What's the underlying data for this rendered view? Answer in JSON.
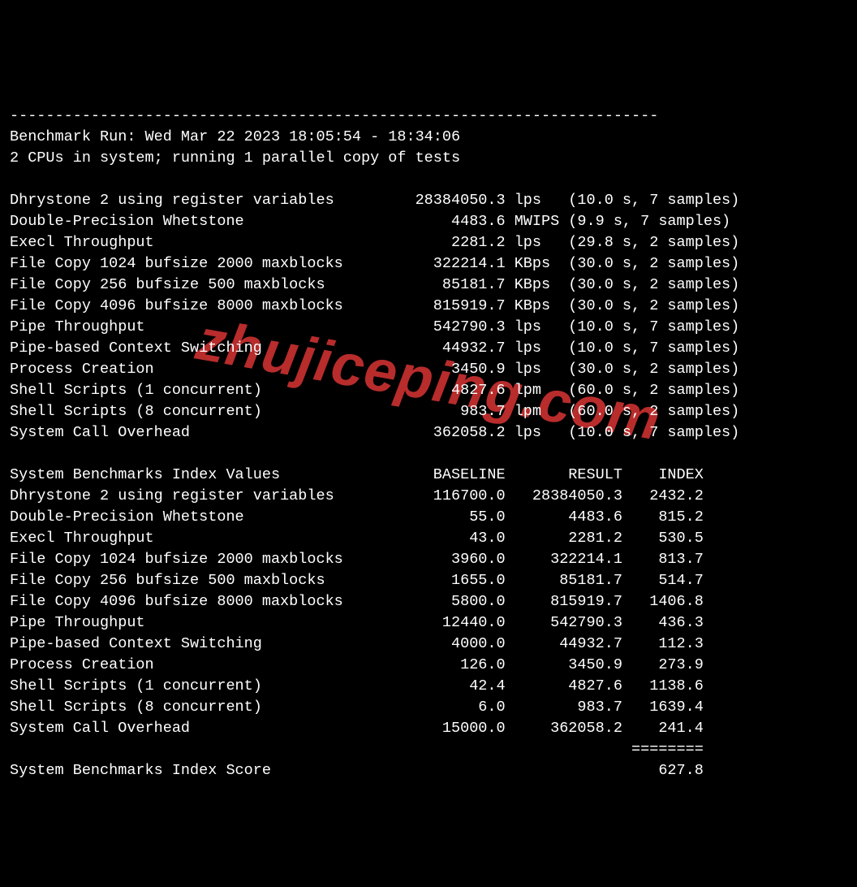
{
  "divider": "------------------------------------------------------------------------",
  "run_line": "Benchmark Run: Wed Mar 22 2023 18:05:54 - 18:34:06",
  "cpu_line": "2 CPUs in system; running 1 parallel copy of tests",
  "tests": [
    {
      "name": "Dhrystone 2 using register variables",
      "value": "28384050.3",
      "unit": "lps",
      "timing": "(10.0 s, 7 samples)"
    },
    {
      "name": "Double-Precision Whetstone",
      "value": "4483.6",
      "unit": "MWIPS",
      "timing": "(9.9 s, 7 samples)"
    },
    {
      "name": "Execl Throughput",
      "value": "2281.2",
      "unit": "lps",
      "timing": "(29.8 s, 2 samples)"
    },
    {
      "name": "File Copy 1024 bufsize 2000 maxblocks",
      "value": "322214.1",
      "unit": "KBps",
      "timing": "(30.0 s, 2 samples)"
    },
    {
      "name": "File Copy 256 bufsize 500 maxblocks",
      "value": "85181.7",
      "unit": "KBps",
      "timing": "(30.0 s, 2 samples)"
    },
    {
      "name": "File Copy 4096 bufsize 8000 maxblocks",
      "value": "815919.7",
      "unit": "KBps",
      "timing": "(30.0 s, 2 samples)"
    },
    {
      "name": "Pipe Throughput",
      "value": "542790.3",
      "unit": "lps",
      "timing": "(10.0 s, 7 samples)"
    },
    {
      "name": "Pipe-based Context Switching",
      "value": "44932.7",
      "unit": "lps",
      "timing": "(10.0 s, 7 samples)"
    },
    {
      "name": "Process Creation",
      "value": "3450.9",
      "unit": "lps",
      "timing": "(30.0 s, 2 samples)"
    },
    {
      "name": "Shell Scripts (1 concurrent)",
      "value": "4827.6",
      "unit": "lpm",
      "timing": "(60.0 s, 2 samples)"
    },
    {
      "name": "Shell Scripts (8 concurrent)",
      "value": "983.7",
      "unit": "lpm",
      "timing": "(60.0 s, 2 samples)"
    },
    {
      "name": "System Call Overhead",
      "value": "362058.2",
      "unit": "lps",
      "timing": "(10.0 s, 7 samples)"
    }
  ],
  "index_header": {
    "title": "System Benchmarks Index Values",
    "col1": "BASELINE",
    "col2": "RESULT",
    "col3": "INDEX"
  },
  "index_rows": [
    {
      "name": "Dhrystone 2 using register variables",
      "baseline": "116700.0",
      "result": "28384050.3",
      "index": "2432.2"
    },
    {
      "name": "Double-Precision Whetstone",
      "baseline": "55.0",
      "result": "4483.6",
      "index": "815.2"
    },
    {
      "name": "Execl Throughput",
      "baseline": "43.0",
      "result": "2281.2",
      "index": "530.5"
    },
    {
      "name": "File Copy 1024 bufsize 2000 maxblocks",
      "baseline": "3960.0",
      "result": "322214.1",
      "index": "813.7"
    },
    {
      "name": "File Copy 256 bufsize 500 maxblocks",
      "baseline": "1655.0",
      "result": "85181.7",
      "index": "514.7"
    },
    {
      "name": "File Copy 4096 bufsize 8000 maxblocks",
      "baseline": "5800.0",
      "result": "815919.7",
      "index": "1406.8"
    },
    {
      "name": "Pipe Throughput",
      "baseline": "12440.0",
      "result": "542790.3",
      "index": "436.3"
    },
    {
      "name": "Pipe-based Context Switching",
      "baseline": "4000.0",
      "result": "44932.7",
      "index": "112.3"
    },
    {
      "name": "Process Creation",
      "baseline": "126.0",
      "result": "3450.9",
      "index": "273.9"
    },
    {
      "name": "Shell Scripts (1 concurrent)",
      "baseline": "42.4",
      "result": "4827.6",
      "index": "1138.6"
    },
    {
      "name": "Shell Scripts (8 concurrent)",
      "baseline": "6.0",
      "result": "983.7",
      "index": "1639.4"
    },
    {
      "name": "System Call Overhead",
      "baseline": "15000.0",
      "result": "362058.2",
      "index": "241.4"
    }
  ],
  "score_rule": "========",
  "score_label": "System Benchmarks Index Score",
  "score_value": "627.8",
  "watermark": "zhujiceping.com"
}
